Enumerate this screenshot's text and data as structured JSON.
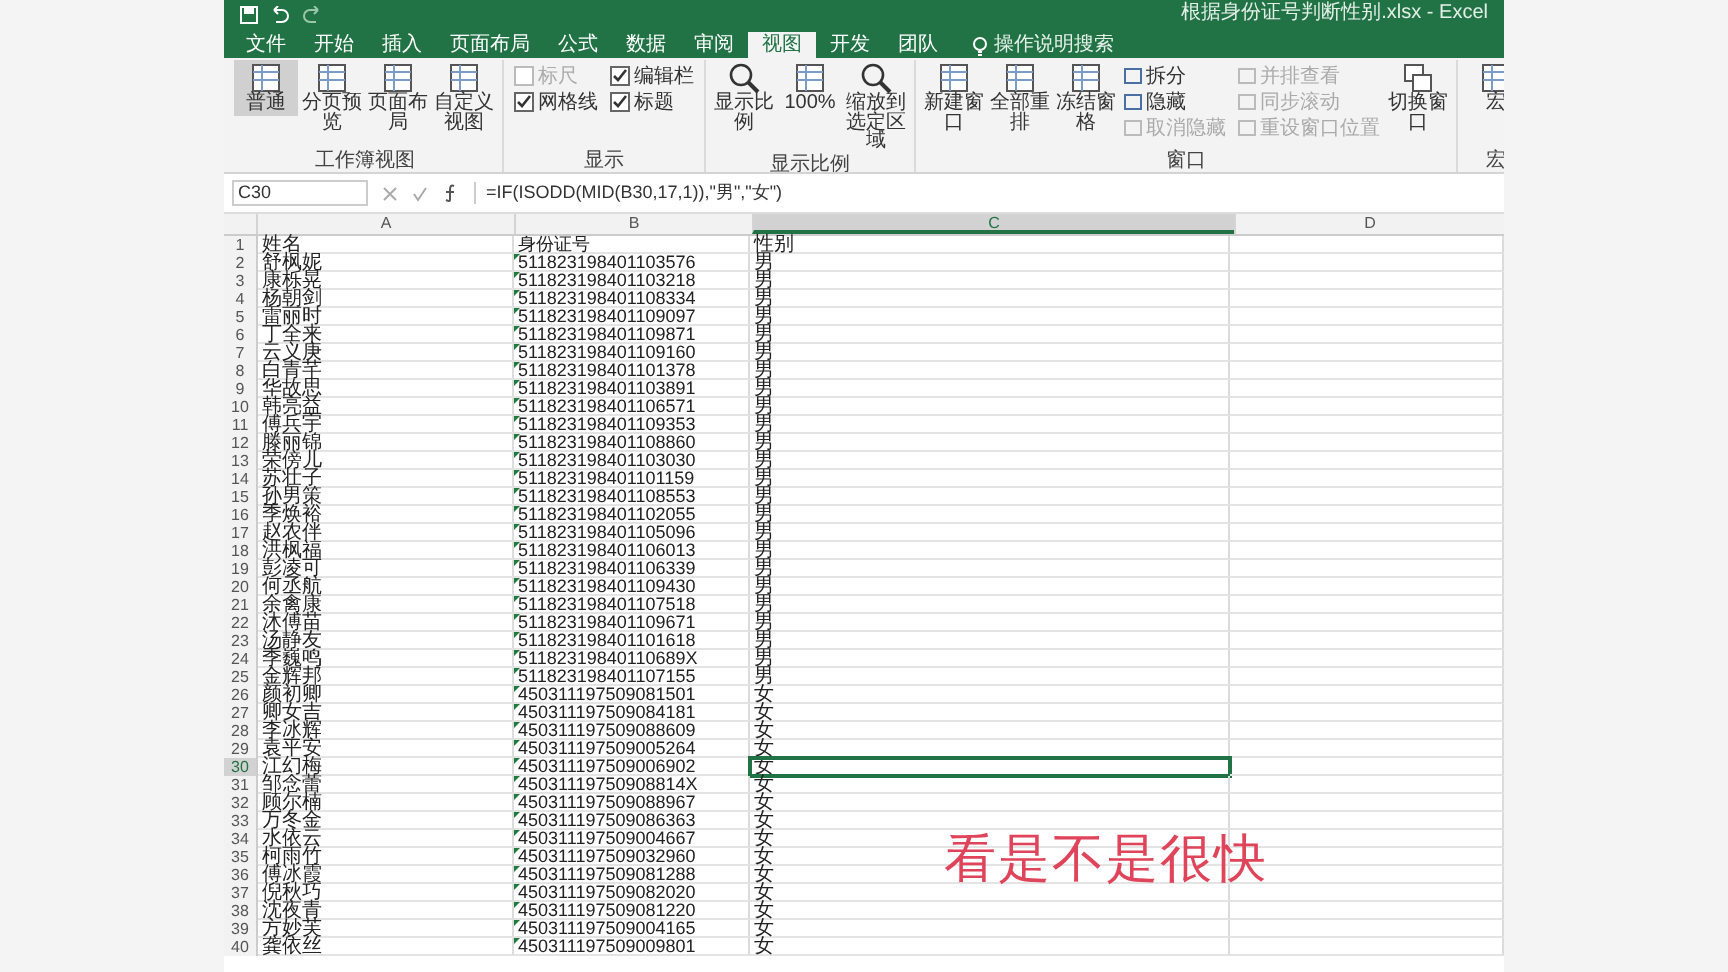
{
  "window": {
    "title": "根据身份证号判断性别.xlsx - Excel"
  },
  "tabs": [
    {
      "label": "文件",
      "selected": false
    },
    {
      "label": "开始",
      "selected": false
    },
    {
      "label": "插入",
      "selected": false
    },
    {
      "label": "页面布局",
      "selected": false
    },
    {
      "label": "公式",
      "selected": false
    },
    {
      "label": "数据",
      "selected": false
    },
    {
      "label": "审阅",
      "selected": false
    },
    {
      "label": "视图",
      "selected": true
    },
    {
      "label": "开发",
      "selected": false
    },
    {
      "label": "团队",
      "selected": false
    }
  ],
  "tell_me": {
    "placeholder": "操作说明搜索"
  },
  "ribbon_groups": [
    {
      "label": "工作簿视图",
      "items": [
        {
          "kind": "large",
          "label": "普通",
          "selected": true
        },
        {
          "kind": "large",
          "label": "分页预览",
          "selected": false
        },
        {
          "kind": "large",
          "label": "页面布局",
          "selected": false
        },
        {
          "kind": "large",
          "label": "自定义视图",
          "selected": false
        }
      ]
    },
    {
      "label": "显示",
      "items": [
        {
          "kind": "check",
          "label": "标尺",
          "checked": false,
          "disabled": true
        },
        {
          "kind": "check",
          "label": "网格线",
          "checked": true,
          "disabled": false
        },
        {
          "kind": "check",
          "label": "编辑栏",
          "checked": true,
          "disabled": false
        },
        {
          "kind": "check",
          "label": "标题",
          "checked": true,
          "disabled": false
        }
      ]
    },
    {
      "label": "显示比例",
      "items": [
        {
          "kind": "zoom",
          "label": "显示比例"
        },
        {
          "kind": "large",
          "label": "100%"
        },
        {
          "kind": "zoom",
          "label": "缩放到选定区域"
        }
      ]
    },
    {
      "label": "窗口",
      "items": [
        {
          "kind": "large",
          "label": "新建窗口"
        },
        {
          "kind": "large",
          "label": "全部重排"
        },
        {
          "kind": "large",
          "label": "冻结窗格"
        },
        {
          "kind": "small",
          "label": "拆分",
          "disabled": false
        },
        {
          "kind": "small",
          "label": "隐藏",
          "disabled": false
        },
        {
          "kind": "small",
          "label": "取消隐藏",
          "disabled": true
        },
        {
          "kind": "small",
          "label": "并排查看",
          "disabled": true
        },
        {
          "kind": "small",
          "label": "同步滚动",
          "disabled": true
        },
        {
          "kind": "small",
          "label": "重设窗口位置",
          "disabled": true
        },
        {
          "kind": "large",
          "label": "切换窗口"
        }
      ]
    },
    {
      "label": "宏",
      "items": [
        {
          "kind": "large",
          "label": "宏"
        }
      ]
    }
  ],
  "formula_bar": {
    "name_box": "C30",
    "formula": "=IF(ISODD(MID(B30,17,1)),\"男\",\"女\")"
  },
  "columns": [
    {
      "label": "A",
      "selected": false
    },
    {
      "label": "B",
      "selected": false
    },
    {
      "label": "C",
      "selected": true
    },
    {
      "label": "D",
      "selected": false
    }
  ],
  "rows": [
    {
      "num": "1",
      "cells": [
        "姓名",
        "身份证号",
        "性别"
      ],
      "selected": false
    },
    {
      "num": "2",
      "cells": [
        "舒枫妮",
        "511823198401103576",
        "男"
      ],
      "selected": false
    },
    {
      "num": "3",
      "cells": [
        "康栎晃",
        "511823198401103218",
        "男"
      ],
      "selected": false
    },
    {
      "num": "4",
      "cells": [
        "杨朝剑",
        "511823198401108334",
        "男"
      ],
      "selected": false
    },
    {
      "num": "5",
      "cells": [
        "雷丽时",
        "511823198401109097",
        "男"
      ],
      "selected": false
    },
    {
      "num": "6",
      "cells": [
        "丁全来",
        "511823198401109871",
        "男"
      ],
      "selected": false
    },
    {
      "num": "7",
      "cells": [
        "云义庚",
        "511823198401109160",
        "男"
      ],
      "selected": false
    },
    {
      "num": "8",
      "cells": [
        "白青芊",
        "511823198401101378",
        "男"
      ],
      "selected": false
    },
    {
      "num": "9",
      "cells": [
        "华故思",
        "511823198401103891",
        "男"
      ],
      "selected": false
    },
    {
      "num": "10",
      "cells": [
        "韩亮益",
        "511823198401106571",
        "男"
      ],
      "selected": false
    },
    {
      "num": "11",
      "cells": [
        "傅兵宇",
        "511823198401109353",
        "男"
      ],
      "selected": false
    },
    {
      "num": "12",
      "cells": [
        "滕丽锦",
        "511823198401108860",
        "男"
      ],
      "selected": false
    },
    {
      "num": "13",
      "cells": [
        "荣傍儿",
        "511823198401103030",
        "男"
      ],
      "selected": false
    },
    {
      "num": "14",
      "cells": [
        "苏壮子",
        "511823198401101159",
        "男"
      ],
      "selected": false
    },
    {
      "num": "15",
      "cells": [
        "孙男策",
        "511823198401108553",
        "男"
      ],
      "selected": false
    },
    {
      "num": "16",
      "cells": [
        "季焕裕",
        "511823198401102055",
        "男"
      ],
      "selected": false
    },
    {
      "num": "17",
      "cells": [
        "赵农伴",
        "511823198401105096",
        "男"
      ],
      "selected": false
    },
    {
      "num": "18",
      "cells": [
        "洪枫福",
        "511823198401106013",
        "男"
      ],
      "selected": false
    },
    {
      "num": "19",
      "cells": [
        "彭凌可",
        "511823198401106339",
        "男"
      ],
      "selected": false
    },
    {
      "num": "20",
      "cells": [
        "何丞航",
        "511823198401109430",
        "男"
      ],
      "selected": false
    },
    {
      "num": "21",
      "cells": [
        "余禽康",
        "511823198401107518",
        "男"
      ],
      "selected": false
    },
    {
      "num": "22",
      "cells": [
        "沐傅苗",
        "511823198401109671",
        "男"
      ],
      "selected": false
    },
    {
      "num": "23",
      "cells": [
        "汤静友",
        "511823198401101618",
        "男"
      ],
      "selected": false
    },
    {
      "num": "24",
      "cells": [
        "季巍鸣",
        "51182319840110689X",
        "男"
      ],
      "selected": false
    },
    {
      "num": "25",
      "cells": [
        "金辉邦",
        "511823198401107155",
        "男"
      ],
      "selected": false
    },
    {
      "num": "26",
      "cells": [
        "颜初卿",
        "450311197509081501",
        "女"
      ],
      "selected": false
    },
    {
      "num": "27",
      "cells": [
        "卿女吉",
        "450311197509084181",
        "女"
      ],
      "selected": false
    },
    {
      "num": "28",
      "cells": [
        "李冰辉",
        "450311197509088609",
        "女"
      ],
      "selected": false
    },
    {
      "num": "29",
      "cells": [
        "袁平安",
        "450311197509005264",
        "女"
      ],
      "selected": false
    },
    {
      "num": "30",
      "cells": [
        "江幻梅",
        "450311197509006902",
        "女"
      ],
      "selected": true
    },
    {
      "num": "31",
      "cells": [
        "邹念蕾",
        "45031119750908814X",
        "女"
      ],
      "selected": false
    },
    {
      "num": "32",
      "cells": [
        "顾尔楠",
        "450311197509088967",
        "女"
      ],
      "selected": false
    },
    {
      "num": "33",
      "cells": [
        "万冬金",
        "450311197509086363",
        "女"
      ],
      "selected": false
    },
    {
      "num": "34",
      "cells": [
        "水依云",
        "450311197509004667",
        "女"
      ],
      "selected": false
    },
    {
      "num": "35",
      "cells": [
        "柯雨竹",
        "450311197509032960",
        "女"
      ],
      "selected": false
    },
    {
      "num": "36",
      "cells": [
        "傅冰霞",
        "450311197509081288",
        "女"
      ],
      "selected": false
    },
    {
      "num": "37",
      "cells": [
        "倪秋巧",
        "450311197509082020",
        "女"
      ],
      "selected": false
    },
    {
      "num": "38",
      "cells": [
        "沈夜青",
        "450311197509081220",
        "女"
      ],
      "selected": false
    },
    {
      "num": "39",
      "cells": [
        "方妙芙",
        "450311197509004165",
        "女"
      ],
      "selected": false
    },
    {
      "num": "40",
      "cells": [
        "龚依丝",
        "450311197509009801",
        "女"
      ],
      "selected": false
    }
  ],
  "subtitle": "看是不是很快"
}
